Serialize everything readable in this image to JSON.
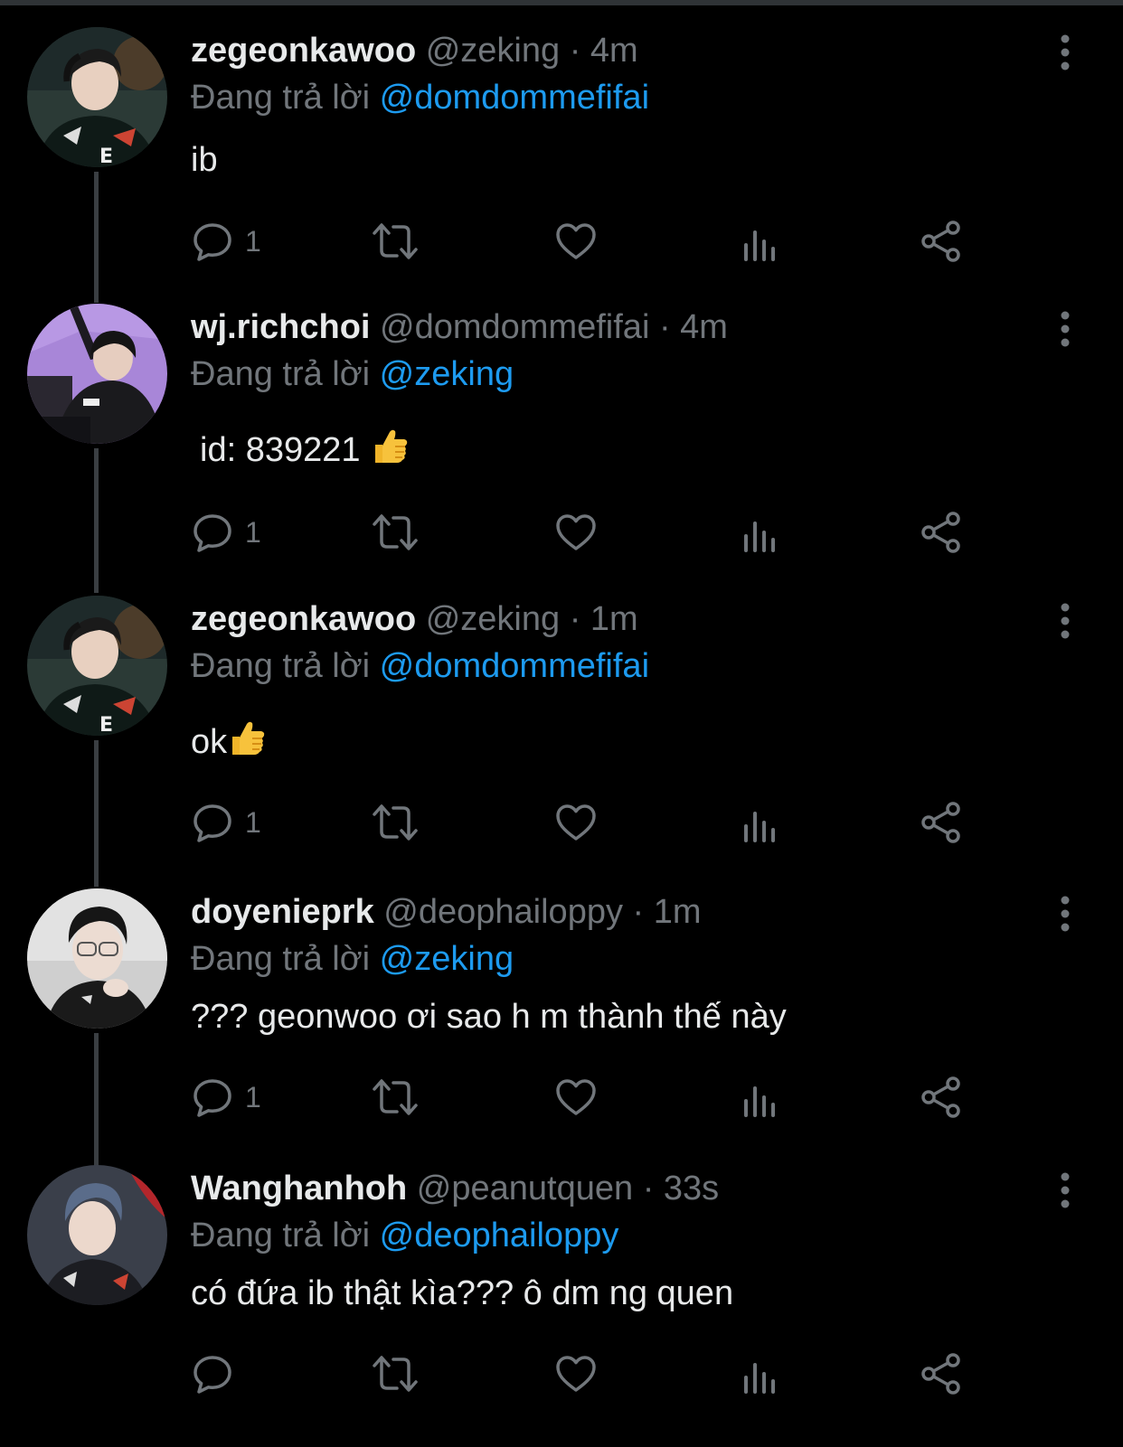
{
  "replying_label": "Đang trả lời",
  "colors": {
    "background": "#000000",
    "text": "#e7e9ea",
    "muted": "#71767b",
    "mention": "#1d9bf0",
    "thread_line": "#3a3e42"
  },
  "tweets": [
    {
      "name": "zegeonkawoo",
      "handle": "@zeking",
      "sep": "·",
      "time": "4m",
      "reply_to": "@domdommefifai",
      "text": "ib",
      "reply_count": "1"
    },
    {
      "name": "wj.richchoi",
      "handle": "@domdommefifai",
      "sep": "·",
      "time": "4m",
      "reply_to": "@zeking",
      "text": "id: 839221",
      "reply_count": "1"
    },
    {
      "name": "zegeonkawoo",
      "handle": "@zeking",
      "sep": "·",
      "time": "1m",
      "reply_to": "@domdommefifai",
      "text": "ok",
      "reply_count": "1"
    },
    {
      "name": "doyenieprk",
      "handle": "@deophailoppy",
      "sep": "·",
      "time": "1m",
      "reply_to": "@zeking",
      "text": "??? geonwoo ơi sao h m thành thế này",
      "reply_count": "1"
    },
    {
      "name": "Wanghanhoh",
      "handle": "@peanutquen",
      "sep": "·",
      "time": "33s",
      "reply_to": "@deophailoppy",
      "text": "có đứa ib thật kìa??? ô dm ng quen",
      "reply_count": ""
    }
  ]
}
